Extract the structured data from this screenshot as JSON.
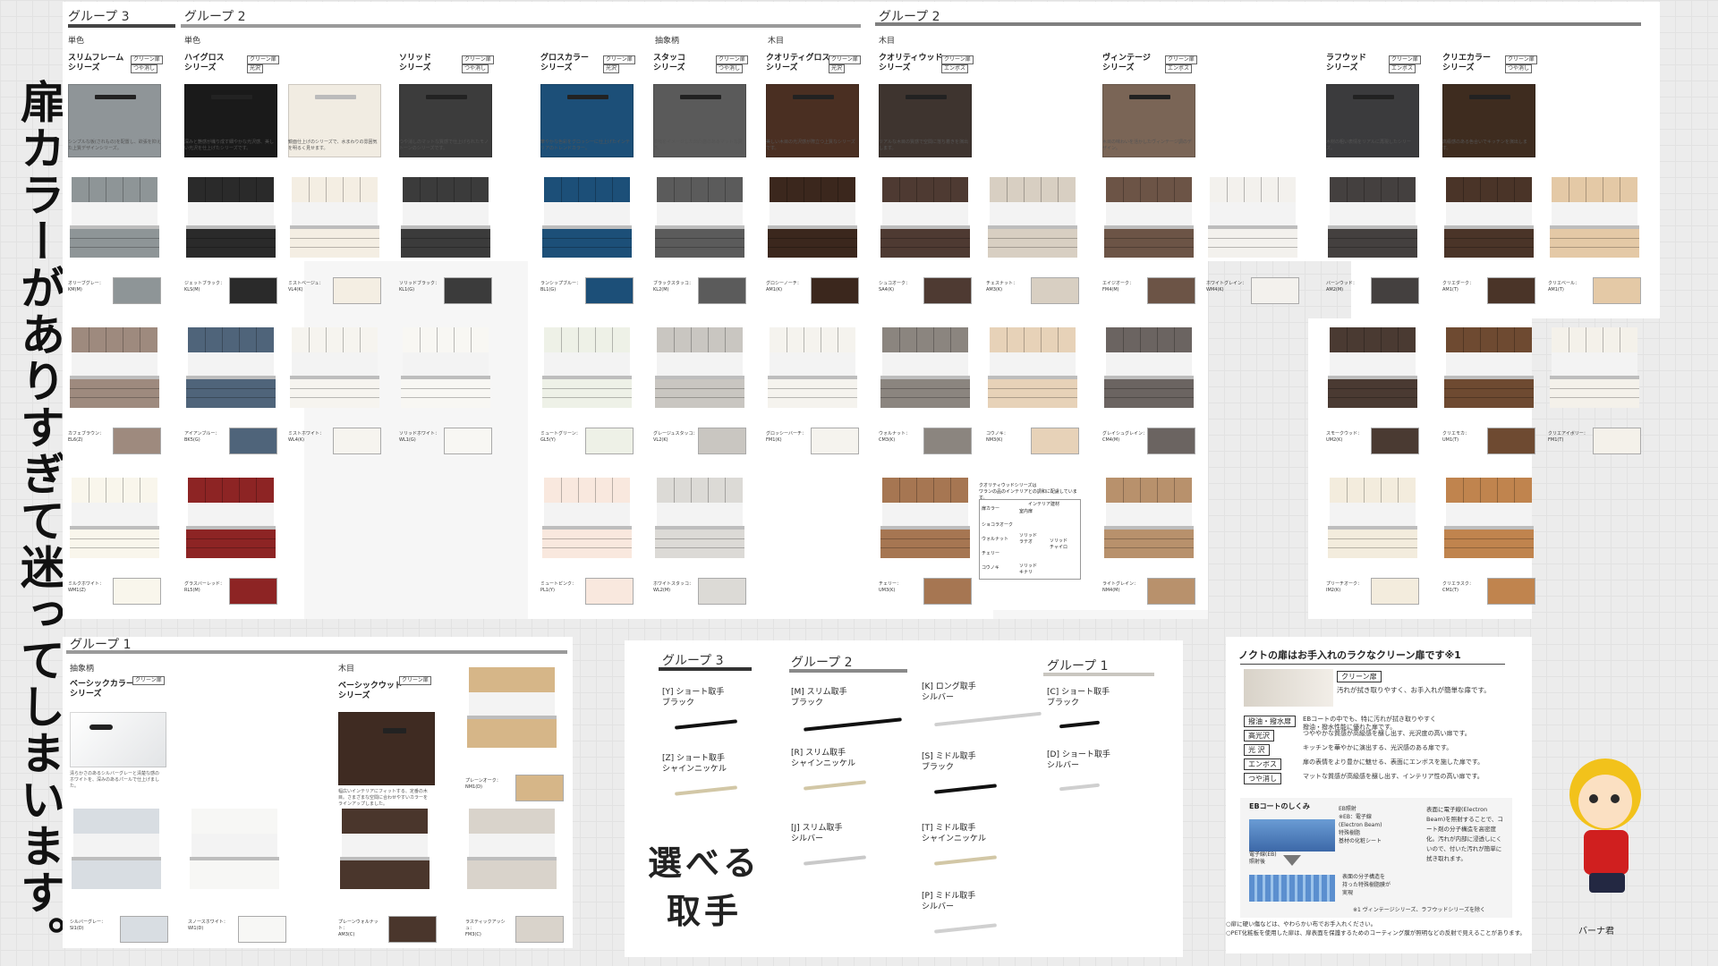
{
  "headline": "扉カラーがありすぎて迷ってしまいます。",
  "groups": {
    "g3_top": "グループ 3",
    "g2_top": "グループ 2",
    "g2_right": "グループ 2",
    "g1": "グループ 1"
  },
  "subheads": {
    "tan1": "単色",
    "tan2": "単色",
    "chusho": "抽象柄",
    "mokume": "木目",
    "mokume2": "木目",
    "chusho_g1": "抽象柄",
    "mokume_g1": "木目"
  },
  "series": [
    {
      "name": "スリムフレーム\nシリーズ",
      "b1": "クリーン扉",
      "b2": "つや消し",
      "desc": "シンプルな板(されもの)を配置し、欲張を抑えた上質デザインシリーズ。",
      "door": "#8f9598"
    },
    {
      "name": "ハイグロス\nシリーズ",
      "b1": "クリーン扉",
      "b2": "光沢",
      "desc": "深みと艶感が織り成す細やかな光沢感、美しい光沢を仕上げたシリーズです。",
      "door": "#1a1a1a"
    },
    {
      "name": "",
      "b1": "",
      "b2": "",
      "desc": "鏡面仕上げのシリーズで、水まわりの雰囲気を明るく見せます。",
      "door": "#f1ece2"
    },
    {
      "name": "ソリッド\nシリーズ",
      "b1": "クリーン扉",
      "b2": "つや消し",
      "desc": "つや消しのマットな質感で仕上げられたモノトーンのシリーズです。",
      "door": "#3c3c3c"
    },
    {
      "name": "グロスカラー\nシリーズ",
      "b1": "クリーン扉",
      "b2": "光沢",
      "desc": "華やかな色彩をグロッシーに仕上げたインテリアのトレンドカラー。",
      "door": "#1c4f78"
    },
    {
      "name": "スタッコ\nシリーズ",
      "b1": "クリーン扉",
      "b2": "つや消し",
      "desc": "漆喰をイメージした凹凸感のあるマットな質感。",
      "door": "#5a5a5a"
    },
    {
      "name": "クオリティグロス\nシリーズ",
      "b1": "クリーン扉",
      "b2": "光沢",
      "desc": "美しい木目の光沢感が際立つ上質なシリーズです。",
      "door": "#4a2f22"
    },
    {
      "name": "クオリティウッド\nシリーズ",
      "b1": "クリーン扉",
      "b2": "エンボス",
      "desc": "リアルな木目の質感で空間に落ち着きを演出します。",
      "door": "#3e342f"
    },
    {
      "name": "ヴィンテージ\nシリーズ",
      "b1": "クリーン扉",
      "b2": "エンボス",
      "desc": "木目の味わいを活かしたヴィンテージ調のデザイン。",
      "door": "#7a6556"
    },
    {
      "name": "ラフウッド\nシリーズ",
      "b1": "クリーン扉",
      "b2": "エンボス",
      "desc": "木材の粗い表情をリアルに再現したシリーズ。",
      "door": "#3b3b3d"
    },
    {
      "name": "クリエカラー\nシリーズ",
      "b1": "クリーン扉",
      "b2": "つや消し",
      "desc": "高級感のある色合いでキッチンを演出します。",
      "door": "#3e2c1f"
    }
  ],
  "colors_row1": [
    {
      "label": "オリーブグレー：\nKM(M)",
      "hex": "#8e9597"
    },
    {
      "label": "ジェットブラック：\nKLS(M)",
      "hex": "#2a2a2a"
    },
    {
      "label": "ミストベージュ：\nVL4(K)",
      "hex": "#f4eee3"
    },
    {
      "label": "ソリッドブラック：\nKL1(G)",
      "hex": "#3b3b3b"
    },
    {
      "label": "ランシップブルー：\nBL1(G)",
      "hex": "#1c4f78"
    },
    {
      "label": "ブラックスタッコ：\nKL2(M)",
      "hex": "#5b5b5b"
    },
    {
      "label": "グロシーノーチ：\nAM1(K)",
      "hex": "#3b271d"
    },
    {
      "label": "シュコオーク：\nSA4(K)",
      "hex": "#4e3a32"
    },
    {
      "label": "チェスナット：\nAM3(K)",
      "hex": "#d8cfc2"
    },
    {
      "label": "エイジオーク：\nFM4(M)",
      "hex": "#6c5446"
    },
    {
      "label": "ホワイトグレイン：\nWM4(K)",
      "hex": "#f3f1ed"
    },
    {
      "label": "バーンウッド：\nAM2(M)",
      "hex": "#44403f"
    },
    {
      "label": "クリエダーク：\nAM1(T)",
      "hex": "#4a3428"
    },
    {
      "label": "クリエベール：\nAM1(T)",
      "hex": "#e4c9a6"
    }
  ],
  "colors_row2": [
    {
      "label": "カフェブラウン：\nEL6(Z)",
      "hex": "#9e8a7e"
    },
    {
      "label": "アイアンブルー：\nBK5(G)",
      "hex": "#4f647a"
    },
    {
      "label": "ミストホワイト：\nWL4(K)",
      "hex": "#f6f4ef"
    },
    {
      "label": "ソリッドホワイト：\nWL1(G)",
      "hex": "#f8f7f3"
    },
    {
      "label": "ミュートグリーン：\nGL5(Y)",
      "hex": "#eef1e7"
    },
    {
      "label": "グレージュスタッコ：\nVL2(K)",
      "hex": "#c9c6c1"
    },
    {
      "label": "グロッシーバーチ：\nFM1(K)",
      "hex": "#f5f3ee"
    },
    {
      "label": "ウォルナット：\nCM3(K)",
      "hex": "#8b857f"
    },
    {
      "label": "コウノキ：\nNM3(K)",
      "hex": "#e7d2b8"
    },
    {
      "label": "グレイシュグレイン：\nCM4(M)",
      "hex": "#6b6461"
    },
    {
      "label": "スモークウッド：\nUM2(K)",
      "hex": "#4a3a32"
    },
    {
      "label": "クリエモカ：\nUM1(T)",
      "hex": "#6e4a31"
    },
    {
      "label": "クリエアイボリー：\nFM1(T)",
      "hex": "#f4f1ea"
    }
  ],
  "colors_row3": [
    {
      "label": "ミルクホワイト：\nWM1(Z)",
      "hex": "#f9f6ec"
    },
    {
      "label": "グラスバーレッド：\nRL5(M)",
      "hex": "#8d2424"
    },
    {
      "label": "ミュートピンク：\nPL1(Y)",
      "hex": "#f9e8de"
    },
    {
      "label": "ホワイトスタッコ：\nWL2(M)",
      "hex": "#dcdad6"
    },
    {
      "label": "チェリー：\nUM3(K)",
      "hex": "#a67652"
    },
    {
      "label": "ライトグレイン：\nNM4(M)",
      "hex": "#b8916c"
    },
    {
      "label": "プリーチオーク：\nIM2(K)",
      "hex": "#f3ecdd"
    },
    {
      "label": "クリエラスク：\nCM1(T)",
      "hex": "#c0844e"
    }
  ],
  "table": {
    "title": "クオリティウッドシリーズは\nワランの品のインテリアとの調和に配慮しています。",
    "h1": "扉カラー",
    "h2": "インテリア建材",
    "h3": "室内扉",
    "rows": [
      "ショコラオーク",
      "ウォルナット",
      "チェリー",
      "コウノキ"
    ],
    "c1": "ソリッド\nウエンゲ",
    "c2": "ソリッド\nラテオ",
    "c3": "ソリッド\nチャイロ",
    "c4": "ソリッド\nキナリ"
  },
  "g1_series": {
    "name1": "ベーシックカラー\nシリーズ",
    "desc1": "清らかさのあるシルバーグレーと清楚な感のホワイトを、深みのあるパールで仕上げました。",
    "name2": "ベーシックウッド\nシリーズ",
    "desc2": "幅広いインテリアにフィットする、定番の木目。さまざまな空間に合わせやすいカラーをラインアップしました。",
    "b1": "クリーン扉",
    "b2": "つや消し",
    "b3": "光沢"
  },
  "g1_colors": [
    {
      "label": "シルバーグレー：\nSI1(D)",
      "hex": "#d8dde2"
    },
    {
      "label": "スノースホワイト：\nWI1(D)",
      "hex": "#f7f7f5"
    },
    {
      "label": "プレーンウォルナット：\nAM3(C)",
      "hex": "#4a362c"
    },
    {
      "label": "ラスティックアッシュ：\nFM3(C)",
      "hex": "#d9d3cb"
    },
    {
      "label": "プレーンオーク：\nNM1(D)",
      "hex": "#d6b688"
    }
  ],
  "handles": {
    "title": "選べる\n取手",
    "g3": "グループ 3",
    "g2": "グループ 2",
    "g1": "グループ 1",
    "items": [
      {
        "label": "[Y] ショート取手\nブラック",
        "color": "#111"
      },
      {
        "label": "[Z] ショート取手\nシャインニッケル",
        "color": "#d2c7a6"
      },
      {
        "label": "[M] スリム取手\nブラック",
        "color": "#111"
      },
      {
        "label": "[R] スリム取手\nシャインニッケル",
        "color": "#d2c7a6"
      },
      {
        "label": "[J] スリム取手\nシルバー",
        "color": "#c9c9c9"
      },
      {
        "label": "[K] ロング取手\nシルバー",
        "color": "#cfcfcf"
      },
      {
        "label": "[S] ミドル取手\nブラック",
        "color": "#111"
      },
      {
        "label": "[T] ミドル取手\nシャインニッケル",
        "color": "#d2c7a6"
      },
      {
        "label": "[P] ミドル取手\nシルバー",
        "color": "#d0d0d0"
      },
      {
        "label": "[C] ショート取手\nブラック",
        "color": "#111"
      },
      {
        "label": "[D] ショート取手\nシルバー",
        "color": "#cfcfcf"
      }
    ]
  },
  "clean": {
    "title": "ノクトの扉はお手入れのラクなクリーン扉です※1",
    "tag": "クリーン扉",
    "tagdesc": "汚れが拭き取りやすく、お手入れが簡単な扉です。",
    "rows": [
      {
        "k": "撥油・撥水扉",
        "v": "EBコートの中でも、特に汚れが拭き取りやすく\n撥油・撥水性能に優れた扉です。"
      },
      {
        "k": "高光沢",
        "v": "つややかな質感が高級感を醸し出す、光沢度の高い扉です。"
      },
      {
        "k": "光 沢",
        "v": "キッチンを華やかに演出する、光沢感のある扉です。"
      },
      {
        "k": "エンボス",
        "v": "扉の表情をより豊かに魅せる、表面にエンボスを施した扉です。"
      },
      {
        "k": "つや消し",
        "v": "マットな質感が高級感を醸し出す、インテリア性の高い扉です。"
      }
    ],
    "eb_title": "EBコートのしくみ",
    "eb_labels": "EB照射\n※EB：電子線\n(Electron Beam)\n特殊樹脂\n基材の化粧シート",
    "eb_before": "電子線(EB)\n照射後",
    "eb_after": "表面の分子構造を\n持った特殊樹脂膜が\n実現",
    "eb_desc": "表面に電子線(Electron Beam)を照射することで、コート剤の分子構造を高密度化。汚れが内部に浸透しにくいので、付いた汚れが簡単に拭き取れます。",
    "footnote1": "※1 ヴィンテージシリーズ、ラフウッドシリーズを除く",
    "footnote2": "○扉に硬い傷などは、やわらかい布でお手入れください。\n○PET化粧板を使用した扉は、扉表面を保護するためのコーティング膜が照明などの反射で見えることがあります。"
  },
  "mascot": "バーナ君"
}
